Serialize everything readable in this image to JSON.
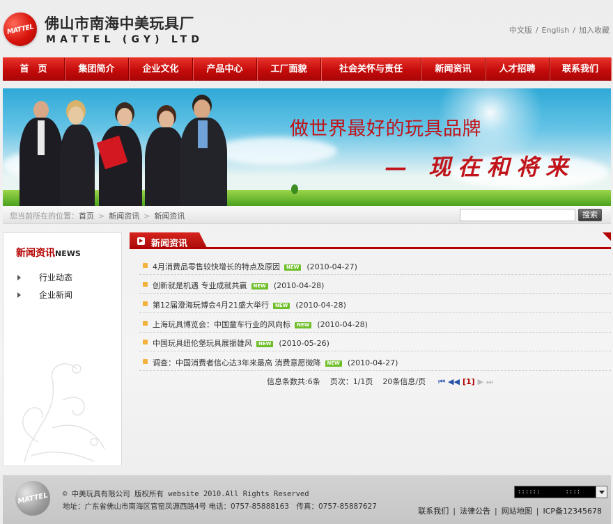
{
  "header": {
    "logo_text": "MATTEL",
    "company_cn": "佛山市南海中美玩具厂",
    "company_en": "MATTEL (GY) LTD",
    "top_links": [
      "中文版",
      "English",
      "加入收藏"
    ]
  },
  "nav": {
    "items": [
      {
        "label": "首　页",
        "width": 89
      },
      {
        "label": "集团简介",
        "width": 92
      },
      {
        "label": "企业文化",
        "width": 92
      },
      {
        "label": "产品中心",
        "width": 92
      },
      {
        "label": "工厂面貌",
        "width": 92
      },
      {
        "label": "社会关怀与责任",
        "width": 144
      },
      {
        "label": "新闻资讯",
        "width": 92
      },
      {
        "label": "人才招聘",
        "width": 92
      },
      {
        "label": "联系我们",
        "width": 88
      }
    ]
  },
  "banner": {
    "slogan_line1": "做世界最好的玩具品牌",
    "slogan_line2": "— 现在和将来"
  },
  "breadcrumb": {
    "prefix": "您当前所在的位置：",
    "items": [
      "首页",
      "新闻资讯",
      "新闻资讯"
    ],
    "search_placeholder": "",
    "search_button": "搜索"
  },
  "sidebar": {
    "title_cn": "新闻资讯",
    "title_en": "NEWS",
    "items": [
      "行业动态",
      "企业新闻"
    ]
  },
  "content": {
    "title": "新闻资讯",
    "new_badge": "NEW",
    "news": [
      {
        "title": "4月消费品零售较快增长的特点及原因",
        "date": "(2010-04-27)"
      },
      {
        "title": "创新就是机遇 专业成就共赢",
        "date": "(2010-04-28)"
      },
      {
        "title": "第12届澄海玩博会4月21盛大举行",
        "date": "(2010-04-28)"
      },
      {
        "title": "上海玩具博览会：中国童车行业的风向标",
        "date": "(2010-04-28)"
      },
      {
        "title": "中国玩具纽伦堡玩具展振雄风",
        "date": "(2010-05-26)"
      },
      {
        "title": "调查：中国消费者信心达3年来最高 消费意愿微降",
        "date": "(2010-04-27)"
      }
    ],
    "pager": {
      "total": "信息条数共:6条",
      "page": "页次：1/1页",
      "per_page": "20条信息/页",
      "first": "⏮",
      "prev": "◀◀",
      "current": "[1]",
      "next": "▶",
      "last": "⏭"
    }
  },
  "footer": {
    "logo_text": "MATTEL",
    "copyright": "© 中美玩具有限公司 版权所有 website 2010.All Rights Reserved",
    "address": "地址：广东省佛山市南海区官窑凤源西路4号 电话：0757-85888163　传真：0757-85887627",
    "select_value": "::::::　　　　::::",
    "links": [
      "联系我们",
      "法律公告",
      "网站地图",
      "ICP备12345678"
    ]
  },
  "colors": {
    "nav_red": "#c40b0b",
    "accent_red": "#b30000",
    "new_badge_green": "#6fbf2a",
    "bullet_orange": "#f3b23b"
  }
}
